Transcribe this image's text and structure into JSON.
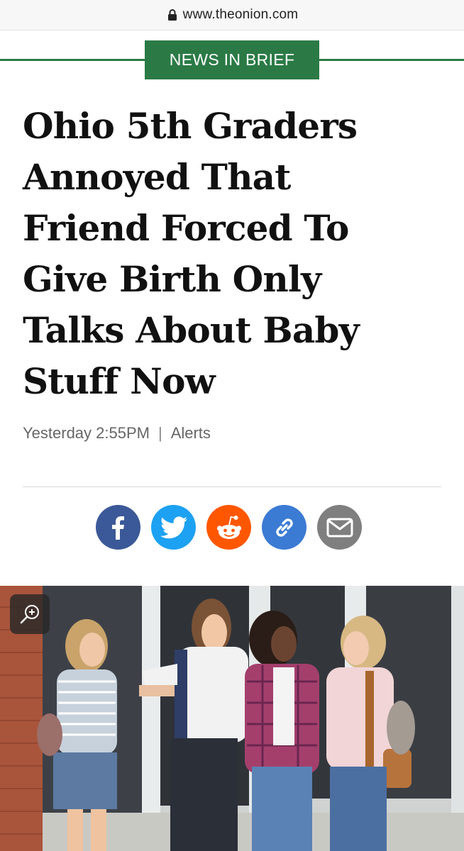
{
  "browser": {
    "url": "www.theonion.com",
    "lock_icon": "lock-icon"
  },
  "article": {
    "section_tag": "NEWS IN BRIEF",
    "headline_lines": [
      "Ohio 5th Graders",
      "Annoyed That",
      "Friend Forced To",
      "Give Birth Only",
      "Talks About Baby",
      "Stuff Now"
    ],
    "timestamp": "Yesterday 2:55PM",
    "separator": "|",
    "category": "Alerts"
  },
  "share": {
    "buttons": [
      {
        "name": "facebook",
        "icon": "facebook-icon",
        "color": "#3b5998"
      },
      {
        "name": "twitter",
        "icon": "twitter-icon",
        "color": "#1da1f2"
      },
      {
        "name": "reddit",
        "icon": "reddit-icon",
        "color": "#ff5700"
      },
      {
        "name": "copy-link",
        "icon": "link-icon",
        "color": "#3b7bd4"
      },
      {
        "name": "email",
        "icon": "mail-icon",
        "color": "#7f7f7f"
      }
    ]
  },
  "image": {
    "zoom_icon": "zoom-in-icon"
  },
  "colors": {
    "accent_green": "#2b7a45"
  }
}
